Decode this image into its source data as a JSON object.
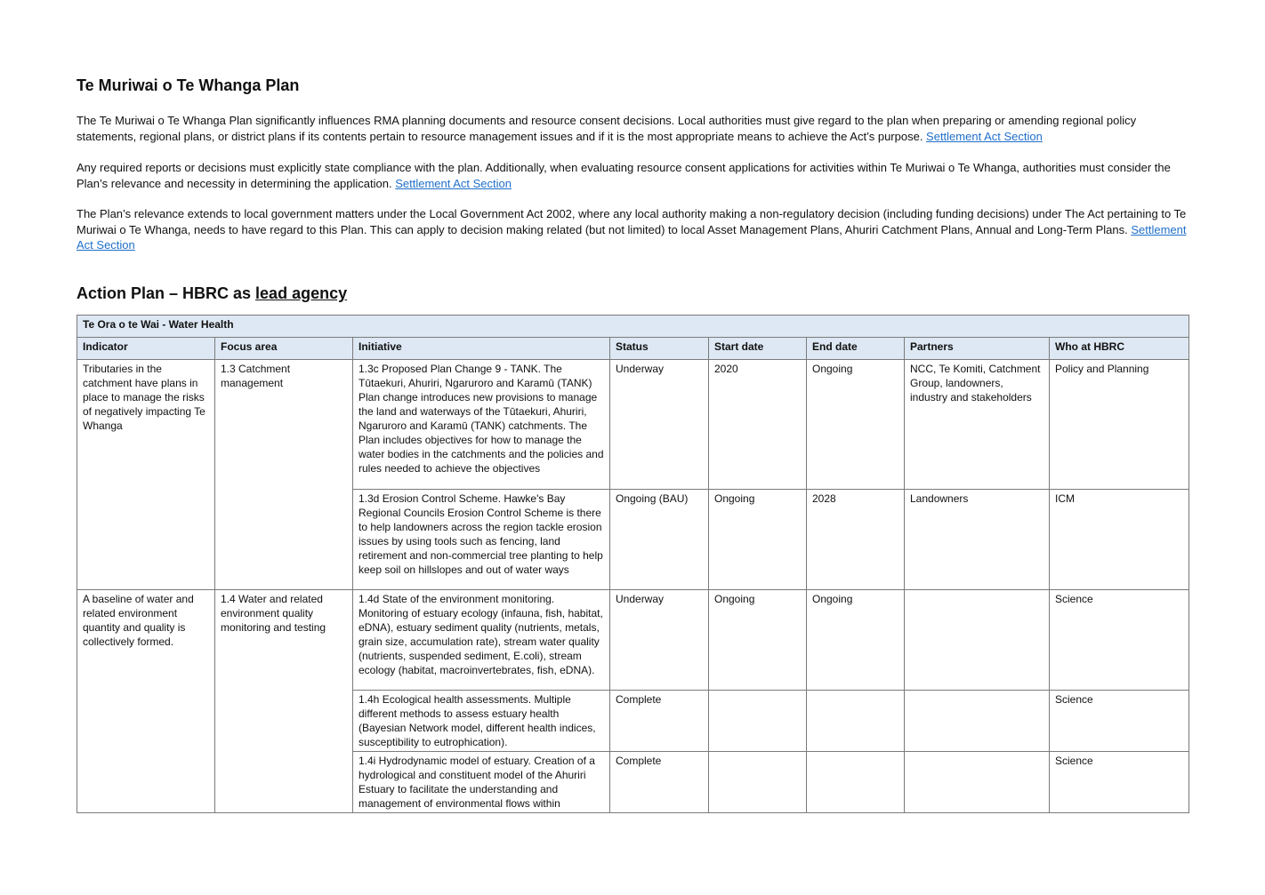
{
  "doc": {
    "title": "Te Muriwai o Te Whanga Plan",
    "paragraphs": [
      {
        "text": "The Te Muriwai o Te Whanga Plan significantly influences RMA planning documents and resource consent decisions. Local authorities must give regard to the plan when preparing or amending regional policy statements, regional plans, or district plans if its contents pertain to resource management issues and if it is the most appropriate means to achieve the Act’s purpose. ",
        "link": "Settlement Act Section"
      },
      {
        "text": "Any required reports or decisions must explicitly state compliance with the plan. Additionally, when evaluating resource consent applications for activities within Te Muriwai o Te Whanga, authorities must consider the Plan’s relevance and necessity in determining the application. ",
        "link": "Settlement Act Section"
      },
      {
        "text": "The Plan’s relevance extends to local government matters under the Local Government Act 2002, where any local authority making a non-regulatory decision (including funding decisions) under The Act pertaining to Te Muriwai o Te Whanga, needs to have regard to this Plan. This can apply to decision making related (but not limited) to local Asset Management Plans, Ahuriri Catchment Plans, Annual and Long-Term Plans. ",
        "link": "Settlement Act Section"
      }
    ],
    "action_heading_prefix": "Action Plan – HBRC as ",
    "action_heading_underlined": "lead agency",
    "link_color": "#1f6fc9",
    "header_fill": "#dde8f4"
  },
  "table": {
    "group_title": "Te Ora o te Wai - Water Health",
    "headers": [
      "Indicator",
      "Focus area",
      "Initiative",
      "Status",
      "Start date",
      "End date",
      "Partners",
      "Who at HBRC"
    ],
    "group1": {
      "indicator": "Tributaries in the catchment have plans in place to manage the risks of negatively impacting Te Whanga",
      "focus": "1.3 Catchment management",
      "rows": [
        {
          "initiative": "1.3c Proposed Plan Change 9 - TANK. The Tūtaekuri, Ahuriri, Ngaruroro and Karamū (TANK) Plan change introduces new provisions to manage the land and waterways of the Tūtaekuri, Ahuriri, Ngaruroro and Karamū (TANK) catchments. The Plan includes objectives for how to manage the water bodies in the catchments and the policies and rules needed to achieve the objectives",
          "status": "Underway",
          "start": "2020",
          "end": "Ongoing",
          "partners": "NCC, Te Komiti, Catchment Group, landowners, industry and stakeholders",
          "who": "Policy and Planning"
        },
        {
          "initiative": "1.3d Erosion Control Scheme. Hawke's Bay Regional Councils Erosion Control Scheme is there to help landowners across the region tackle erosion issues by using tools such as fencing, land retirement and non-commercial tree planting to help keep soil on hillslopes and out of water ways",
          "status": "Ongoing (BAU)",
          "start": "Ongoing",
          "end": "2028",
          "partners": "Landowners",
          "who": "ICM"
        }
      ]
    },
    "group2": {
      "indicator": "A baseline of water and related environment quantity and quality is collectively formed.",
      "focus": "1.4 Water and related environment quality monitoring and testing",
      "rows": [
        {
          "initiative": "1.4d State of the environment monitoring. Monitoring of estuary ecology (infauna, fish, habitat, eDNA), estuary sediment quality (nutrients, metals, grain size, accumulation rate), stream water quality (nutrients, suspended sediment, E.coli), stream ecology (habitat, macroinvertebrates, fish, eDNA).",
          "status": "Underway",
          "start": "Ongoing",
          "end": "Ongoing",
          "partners": "",
          "who": "Science"
        },
        {
          "initiative": "1.4h Ecological health assessments. Multiple different methods to assess estuary health (Bayesian Network model, different health indices, susceptibility to eutrophication).",
          "status": "Complete",
          "start": "",
          "end": "",
          "partners": "",
          "who": "Science"
        },
        {
          "initiative": "1.4i Hydrodynamic model of estuary. Creation of a hydrological and constituent model of the Ahuriri Estuary to facilitate the understanding and management of environmental flows within",
          "status": "Complete",
          "start": "",
          "end": "",
          "partners": "",
          "who": "Science"
        }
      ]
    }
  }
}
